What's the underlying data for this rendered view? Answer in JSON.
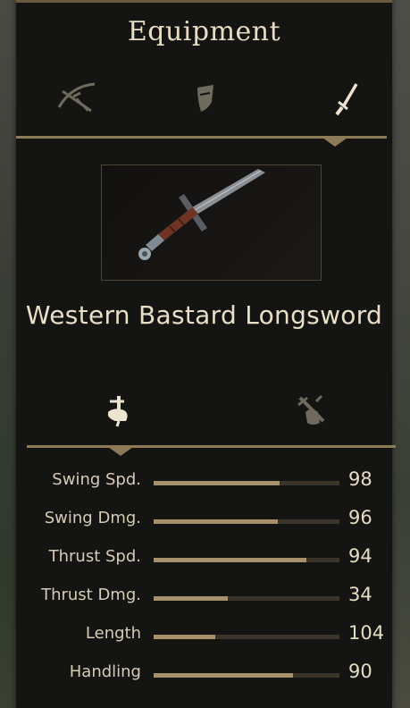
{
  "panel": {
    "title": "Equipment"
  },
  "tabs": [
    {
      "icon": "crossbow-icon",
      "selected": false
    },
    {
      "icon": "shield-icon",
      "selected": false
    },
    {
      "icon": "sword-icon",
      "selected": true
    }
  ],
  "item": {
    "name": "Western Bastard Longsword",
    "icon": "longsword-icon"
  },
  "modes": [
    {
      "icon": "one-handed-mode-icon",
      "selected": true
    },
    {
      "icon": "two-handed-mode-icon",
      "selected": false
    }
  ],
  "stats": [
    {
      "label": "Swing Spd.",
      "value": "98",
      "fill": 0.68
    },
    {
      "label": "Swing Dmg.",
      "value": "96",
      "fill": 0.67
    },
    {
      "label": "Thrust Spd.",
      "value": "94",
      "fill": 0.82
    },
    {
      "label": "Thrust Dmg.",
      "value": "34",
      "fill": 0.4
    },
    {
      "label": "Length",
      "value": "104",
      "fill": 0.33
    },
    {
      "label": "Handling",
      "value": "90",
      "fill": 0.75
    }
  ],
  "colors": {
    "accent": "#8c7a58",
    "text": "#e7dcc4",
    "bar_fill": "#a6916b",
    "panel": "#141412"
  }
}
